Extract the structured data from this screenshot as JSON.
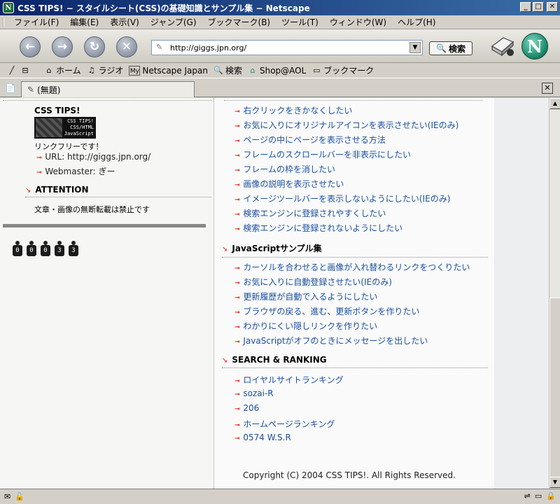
{
  "window": {
    "title": "CSS TIPS! − スタイルシート(CSS)の基礎知識とサンプル集 − Netscape",
    "app_icon": "N",
    "min": "_",
    "max": "□",
    "close": "✕"
  },
  "menu": {
    "items": [
      "ファイル(F)",
      "編集(E)",
      "表示(V)",
      "ジャンプ(G)",
      "ブックマーク(B)",
      "ツール(T)",
      "ウィンドウ(W)",
      "ヘルプ(H)"
    ]
  },
  "navbar": {
    "back": "←",
    "forward": "→",
    "reload": "↻",
    "stop": "✕",
    "url": "http://giggs.jpn.org/",
    "search_label": "検索",
    "logo": "N"
  },
  "personal_toolbar": {
    "items": [
      {
        "icon": "home-icon",
        "glyph": "⌂",
        "label": "ホーム"
      },
      {
        "icon": "radio-icon",
        "glyph": "♫",
        "label": "ラジオ"
      },
      {
        "icon": "my-icon",
        "glyph": "My",
        "label": "Netscape Japan"
      },
      {
        "icon": "search-icon",
        "glyph": "🔍",
        "label": "検索"
      },
      {
        "icon": "shop-icon",
        "glyph": "⌂",
        "label": "Shop@AOL"
      },
      {
        "icon": "folder-icon",
        "glyph": "▭",
        "label": "ブックマーク"
      }
    ]
  },
  "tabs": {
    "active_label": "(無題)",
    "close": "✕"
  },
  "left": {
    "site_name": "CSS TIPS!",
    "banner_lines": [
      "CSS TIPS!",
      "CSS/HTML",
      "JavaScript"
    ],
    "link_free": "リンクフリーです！",
    "url_link": "URL: http://giggs.jpn.org/",
    "webmaster_link": "Webmaster: ぎー",
    "attention_heading": "ATTENTION",
    "notice": "文章・画像の無断転載は禁止です",
    "counter_digits": [
      "0",
      "0",
      "0",
      "3",
      "3"
    ]
  },
  "main": {
    "css_links": [
      "右クリックをきかなくしたい",
      "お気に入りにオリジナルアイコンを表示させたい(IEのみ)",
      "ページの中にページを表示させる方法",
      "フレームのスクロールバーを非表示にしたい",
      "フレームの枠を消したい",
      "画像の説明を表示させたい",
      "イメージツールバーを表示しないようにしたい(IEのみ)",
      "検索エンジンに登録されやすくしたい",
      "検索エンジンに登録されないようにしたい"
    ],
    "js_heading": "JavaScriptサンプル集",
    "js_links": [
      "カーソルを合わせると画像が入れ替わるリンクをつくりたい",
      "お気に入りに自動登録させたい(IEのみ)",
      "更新履歴が自動で入るようにしたい",
      "ブラウザの戻る、進む、更新ボタンを作りたい",
      "わかりにくい隠しリンクを作りたい",
      "JavaScriptがオフのときにメッセージを出したい"
    ],
    "ranking_heading": "SEARCH & RANKING",
    "ranking_links": [
      "ロイヤルサイトランキング",
      "sozai-R",
      "206",
      "ホームページランキング",
      "0574 W.S.R"
    ],
    "copyright": "Copyright (C) 2004 CSS TIPS!. All Rights Reserved."
  },
  "scrollbar": {
    "up": "▲",
    "down": "▼"
  }
}
